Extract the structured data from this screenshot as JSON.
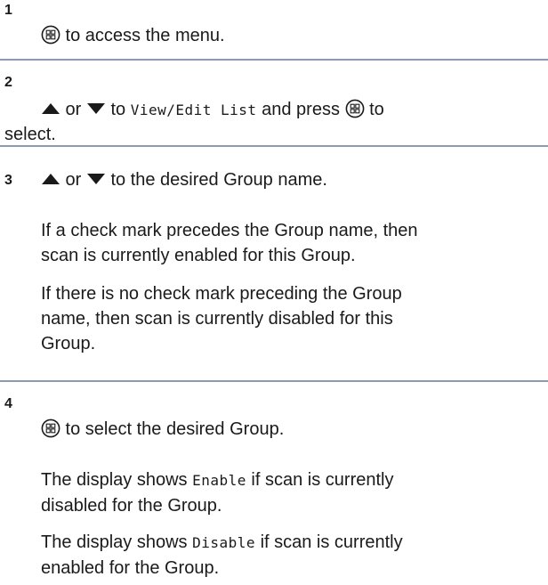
{
  "steps": [
    {
      "number": "1",
      "text_after_icon": " to access the menu."
    },
    {
      "number": "2",
      "or": " or ",
      "to": " to ",
      "target": "View/Edit List",
      "and_press": " and press ",
      "to_tail": " to",
      "line2": "select."
    },
    {
      "number": "3",
      "or": " or ",
      "tail": " to the desired Group name.",
      "para1_l1": "If a check mark precedes the Group name, then",
      "para1_l2": "scan is currently enabled for this Group.",
      "para2_l1": "If there is no check mark preceding the Group",
      "para2_l2": "name, then scan is currently disabled for this",
      "para2_l3": "Group."
    },
    {
      "number": "4",
      "text_after_icon": " to select the desired Group.",
      "p1_pre": "The display shows ",
      "p1_code": "Enable",
      "p1_post": " if scan is currently",
      "p1_l2": "disabled for the Group.",
      "p2_pre": "The display shows ",
      "p2_code": "Disable",
      "p2_post": " if scan is currently",
      "p2_l2": "enabled for the Group."
    }
  ],
  "icons": {
    "menu_button": "menu-ok-button-icon",
    "up": "up-arrow-icon",
    "down": "down-arrow-icon"
  },
  "colors": {
    "rule": "#8a9bb0",
    "text": "#1a1a1a"
  }
}
